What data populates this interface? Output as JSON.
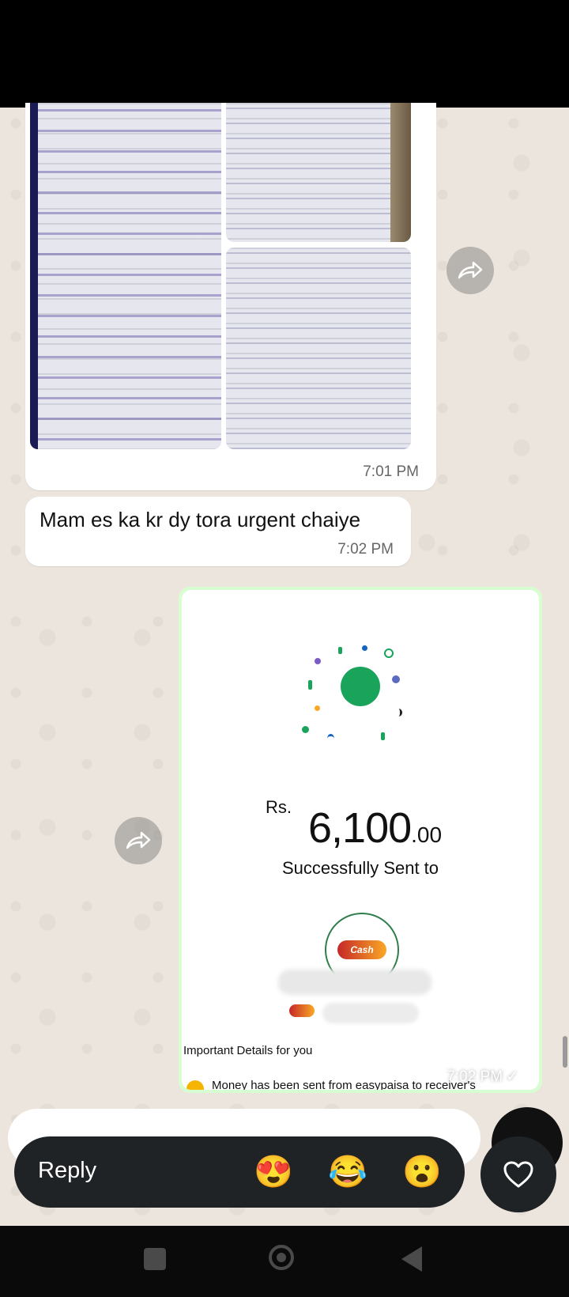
{
  "messages": {
    "image_message": {
      "time": "7:01 PM"
    },
    "text_message": {
      "text": "Mam es ka kr dy tora urgent chaiye",
      "time": "7:02 PM"
    },
    "receipt": {
      "currency": "Rs.",
      "amount_main": "6,100",
      "amount_cents": ".00",
      "status": "Successfully Sent to",
      "wallet_logo": "Cash",
      "section_title": "Important Details for you",
      "detail_line": "Money has been sent from easypaisa to receiver's",
      "time": "7:02 PM",
      "tick": "✓"
    }
  },
  "reactions": {
    "reply_label": "Reply",
    "emojis": [
      "😍",
      "😂",
      "😮"
    ],
    "heart": "heart-icon"
  },
  "colors": {
    "success_green": "#1aa35a",
    "outgoing_bubble": "#d9fdd3",
    "reaction_bar": "#1f2326"
  }
}
